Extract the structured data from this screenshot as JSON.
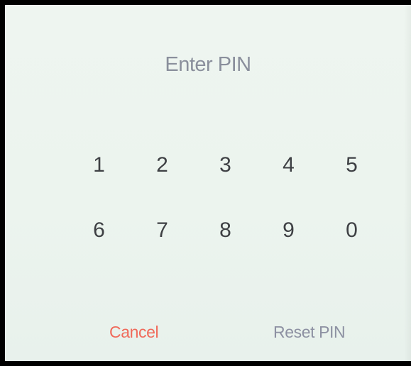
{
  "screen": {
    "title": "Enter PIN"
  },
  "keypad": {
    "keys": [
      "1",
      "2",
      "3",
      "4",
      "5",
      "6",
      "7",
      "8",
      "9",
      "0"
    ]
  },
  "actions": {
    "cancel_label": "Cancel",
    "reset_label": "Reset PIN"
  },
  "colors": {
    "title": "#8a8f9c",
    "digit": "#3e4044",
    "cancel": "#f06a5a",
    "reset": "#8d91a2",
    "background": "#eef5f0"
  }
}
